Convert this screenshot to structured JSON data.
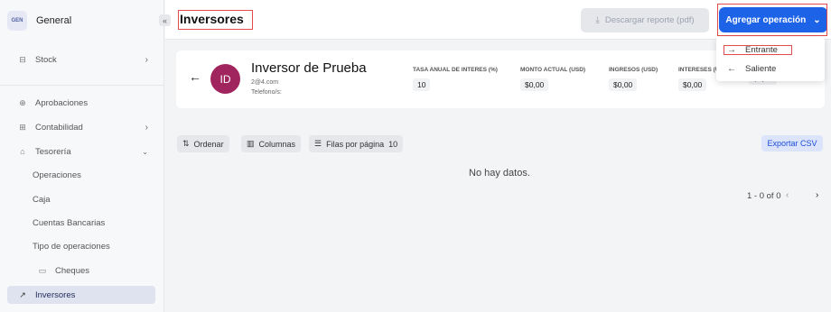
{
  "sidebar": {
    "workspace_badge": "GEN",
    "workspace_name": "General",
    "collapse_glyph": "«",
    "stock": "Stock",
    "aprobaciones": "Aprobaciones",
    "contabilidad": "Contabilidad",
    "tesoreria": "Tesorería",
    "operaciones": "Operaciones",
    "caja": "Caja",
    "cuentas": "Cuentas Bancarias",
    "tipo_operaciones": "Tipo de operaciones",
    "cheques": "Cheques",
    "inversores": "Inversores"
  },
  "header": {
    "title": "Inversores",
    "download_label": "Descargar reporte (pdf)",
    "add_label": "Agregar operación"
  },
  "menu": {
    "entrante": "Entrante",
    "saliente": "Saliente"
  },
  "investor": {
    "initials": "ID",
    "name": "Inversor de Prueba",
    "email": "2@4.com",
    "phone": "Telefono/s:",
    "metrics": [
      {
        "label": "TASA ANUAL DE INTERES (%)",
        "value": "10"
      },
      {
        "label": "MONTO ACTUAL (USD)",
        "value": "$0,00"
      },
      {
        "label": "INGRESOS (USD)",
        "value": "$0,00"
      },
      {
        "label": "INTERESES (U",
        "value": "$0,00"
      },
      {
        "label": "",
        "value": "$0,00"
      }
    ]
  },
  "toolbar": {
    "ordenar": "Ordenar",
    "columnas": "Columnas",
    "filas_label": "Filas por página",
    "filas_value": "10",
    "export": "Exportar CSV"
  },
  "table": {
    "empty": "No hay datos.",
    "pagination": "1 - 0 of 0"
  },
  "colors": {
    "primary": "#1d63e8",
    "avatar": "#a0245e",
    "highlight": "#e24b4b"
  }
}
